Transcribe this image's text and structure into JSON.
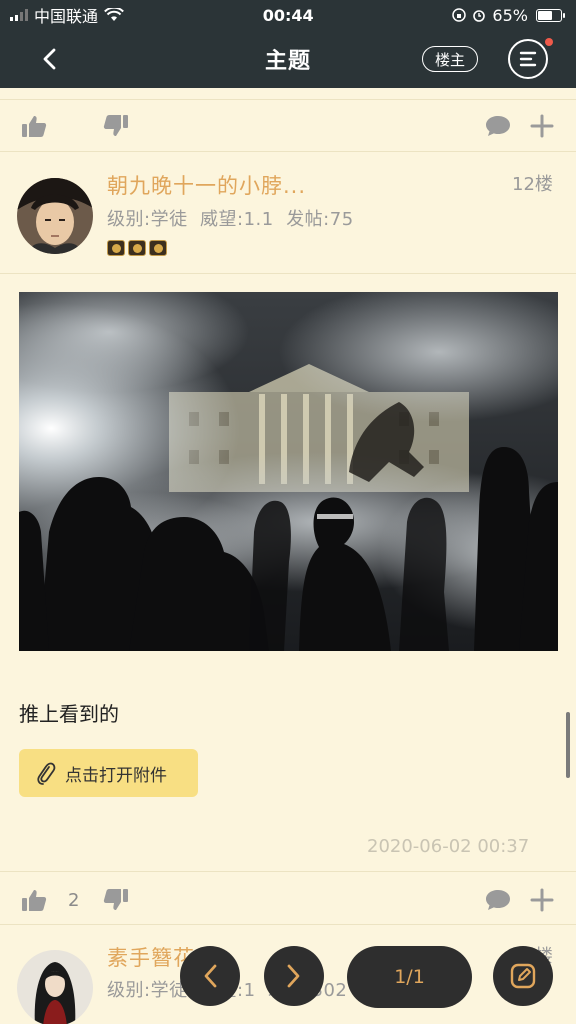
{
  "status_bar": {
    "carrier": "中国联通",
    "time": "00:44",
    "battery": "65%",
    "battery_level": 0.65
  },
  "navbar": {
    "title": "主题",
    "owner_label": "楼主"
  },
  "post": {
    "username": "朝九晚十一的小脖...",
    "floor": "12楼",
    "level_label": "级别:学徒",
    "prestige_label": "威望:1.1",
    "posts_label": "发帖:75",
    "badge_icons": [
      "medal-icon",
      "medal-icon",
      "medal-icon"
    ],
    "text": "推上看到的",
    "attachment_label": "点击打开附件",
    "timestamp": "2020-06-02 00:37",
    "like_count": "2"
  },
  "next_post": {
    "username": "素手簪花",
    "floor": "13楼",
    "meta": "级别:学徒  威望:1  发帖:302"
  },
  "pagination": {
    "page": "1/1"
  },
  "colors": {
    "header_bg": "#2b3437",
    "page_bg": "#fcf5dd",
    "accent": "#e0a65c",
    "attachment_bg": "#f8df83"
  }
}
